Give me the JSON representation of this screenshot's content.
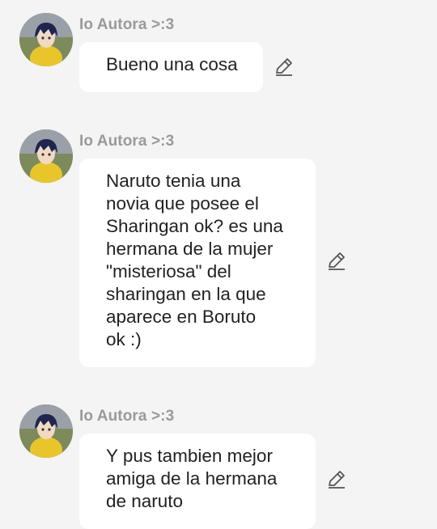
{
  "messages": [
    {
      "author": "Io Autora >:3",
      "lines": [
        "Bueno una cosa"
      ],
      "edit_icon": "pencil-icon"
    },
    {
      "author": "Io Autora >:3",
      "lines": [
        "Naruto tenia una",
        "novia que posee el",
        "Sharingan ok? es una",
        "hermana de la mujer",
        "\"misteriosa\" del",
        "sharingan en la que",
        "aparece en Boruto",
        "ok :)"
      ],
      "edit_icon": "pencil-icon"
    },
    {
      "author": "Io Autora >:3",
      "lines": [
        "Y pus tambien mejor",
        "amiga de la hermana",
        "de naruto"
      ],
      "edit_icon": "pencil-icon"
    }
  ],
  "colors": {
    "background": "#f4f4f4",
    "bubble": "#ffffff",
    "author": "#9a9a9a",
    "text": "#222222",
    "icon": "#555555"
  }
}
